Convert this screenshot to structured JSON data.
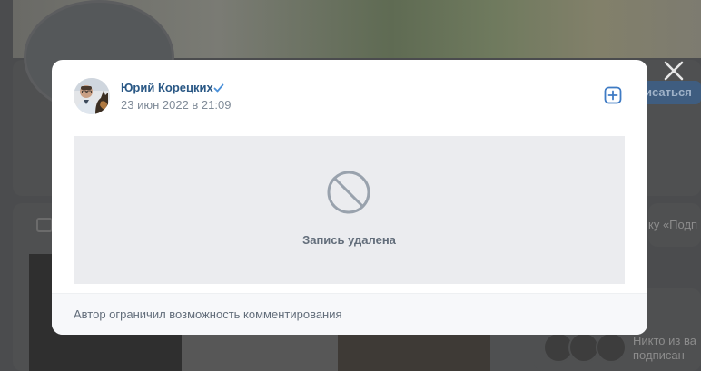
{
  "post": {
    "author_name": "Юрий Корецких",
    "date": "23 июн 2022 в 21:09",
    "deleted_message": "Запись удалена",
    "comments_notice": "Автор ограничил возможность комментирования"
  },
  "background": {
    "subscribe_label": "исаться",
    "right_snippet": "ку «Подп",
    "no_one_text_line1": "Никто из ва",
    "no_one_text_line2": "подписан"
  },
  "colors": {
    "accent": "#2a5885",
    "verified": "#4a90d9",
    "deleted_bg": "#ebecef",
    "footer_bg": "#f7f8fa"
  },
  "icons": {
    "close": "close-icon",
    "verified": "verified-check-icon",
    "add": "add-square-icon",
    "deleted": "blocked-circle-icon"
  }
}
